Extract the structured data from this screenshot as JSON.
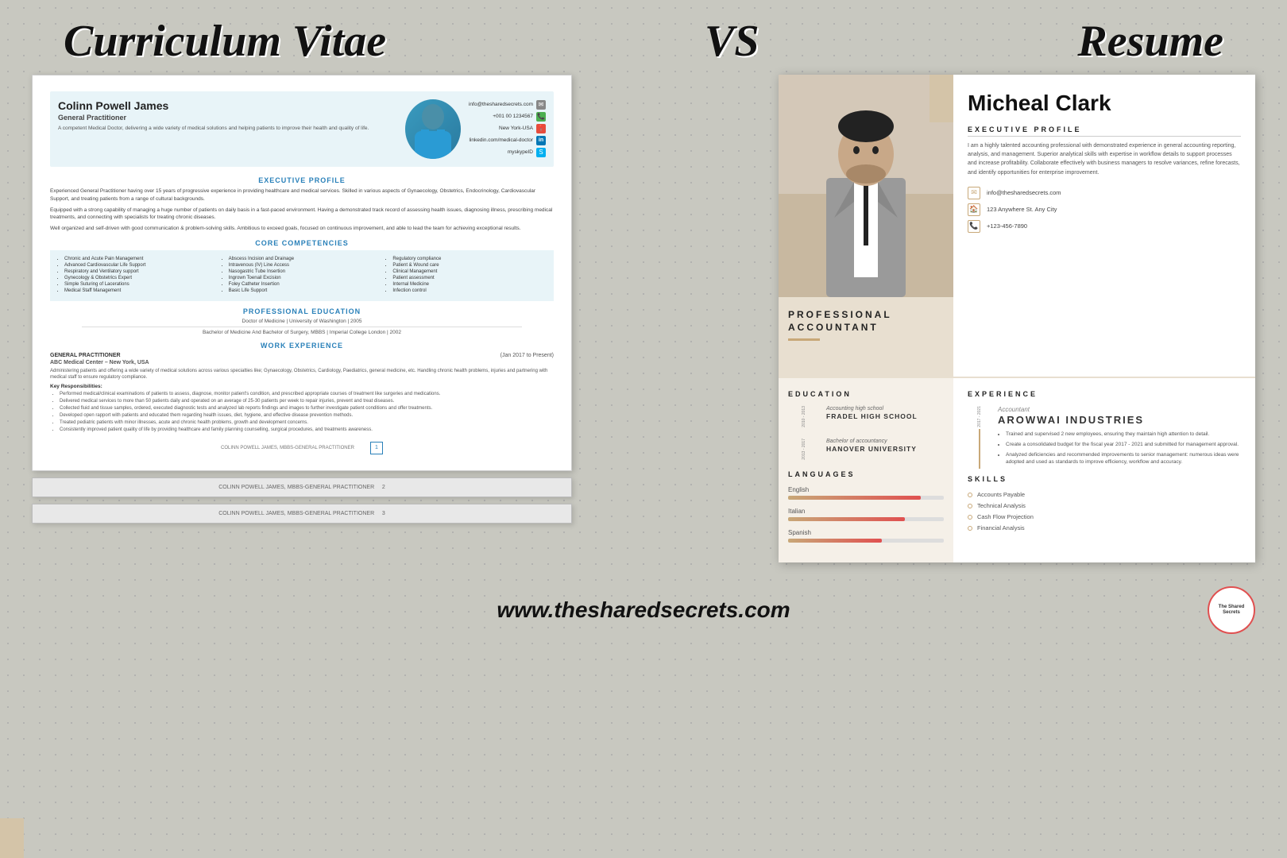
{
  "header": {
    "cv_title": "Curriculum Vitae",
    "vs_text": "VS",
    "resume_title": "Resume"
  },
  "cv": {
    "name": "Colinn Powell James",
    "job_title": "General Practitioner",
    "description": "A competent Medical Doctor, delivering a wide variety of medical solutions and helping patients to improve their health and quality of life.",
    "contact": {
      "email": "info@thesharedsecrets.com",
      "phone": "+001 00 1234567",
      "location": "New York-USA",
      "linkedin": "linkedin.com/medical-doctor",
      "skype": "myskypeID"
    },
    "executive_profile_title": "EXECUTIVE PROFILE",
    "profile_text_1": "Experienced General Practitioner having over 15 years of progressive experience in providing healthcare and medical services. Skilled in various aspects of Gynaecology, Obstetrics, Endocrinology, Cardiovascular Support, and treating patients from a range of cultural backgrounds.",
    "profile_text_2": "Equipped with a strong capability of managing a huge number of patients on daily basis in a fast-paced environment. Having a demonstrated track record of assessing health issues, diagnosing illness, prescribing medical treatments, and connecting with specialists for treating chronic diseases.",
    "profile_text_3": "Well organized and self-driven with good communication & problem-solving skills. Ambitious to exceed goals, focused on continuous improvement, and able to lead the team for achieving exceptional results.",
    "competencies_title": "CORE COMPETENCIES",
    "competencies_col1": [
      "Chronic and Acute Pain Management",
      "Advanced Cardiovascular Life Support",
      "Respiratory and Ventilatory support",
      "Gynecology & Obstetrics Expert",
      "Simple Suturing of Lacerations",
      "Medical Staff Management"
    ],
    "competencies_col2": [
      "Abscess Incision and Drainage",
      "Intravenous (IV) Line Access",
      "Nasogastric Tube Insertion",
      "Ingrown Toenail Excision",
      "Foley Catheter Insertion",
      "Basic Life Support"
    ],
    "competencies_col3": [
      "Regulatory compliance",
      "Patient & Wound care",
      "Clinical Management",
      "Patient assessment",
      "Internal Medicine",
      "Infection control"
    ],
    "education_title": "PROFESSIONAL EDUCATION",
    "edu_1": "Doctor of Medicine | University of Washington | 2005",
    "edu_2": "Bachelor of Medicine And Bachelor of Surgery, MBBS | Imperial College London | 2002",
    "work_title": "WORK EXPERIENCE",
    "work_role": "GENERAL PRACTITIONER",
    "work_org": "ABC Medical Center – New York, USA",
    "work_date": "(Jan 2017 to Present)",
    "work_desc": "Administering patients and offering a wide variety of medical solutions across various specialties like; Gynaecology, Obstetrics, Cardiology, Paediatrics, general medicine, etc. Handling chronic health problems, injuries and partnering with medical staff to ensure regulatory compliance.",
    "work_resp_title": "Key Responsibilities:",
    "work_bullets": [
      "Performed medical/clinical examinations of patients to assess, diagnose, monitor patient's condition, and prescribed appropriate courses of treatment like surgeries and medications.",
      "Delivered medical services to more than 50 patients daily and operated on an average of 25-30 patients per week to repair injuries, prevent and treat diseases.",
      "Collected fluid and tissue samples, ordered, executed diagnostic tests and analyzed lab reports findings and images to further investigate patient conditions and offer treatments.",
      "Developed open rapport with patients and educated them regarding health issues, diet, hygiene, and effective disease prevention methods.",
      "Treated pediatric patients with minor illnesses, acute and chronic health problems, growth and development concerns.",
      "Consistently improved patient quality of life by providing healthcare and family planning counselling, surgical procedures, and treatments awareness."
    ],
    "footer_text": "COLINN POWELL JAMES, MBBS-GENERAL PRACTITIONER",
    "page_num": "1",
    "page2_footer": "COLINN POWELL JAMES, MBBS-GENERAL PRACTITIONER",
    "page2_num": "2",
    "page3_footer": "COLINN POWELL JAMES, MBBS-GENERAL PRACTITIONER",
    "page3_num": "3"
  },
  "resume": {
    "name": "Micheal Clark",
    "prof_title_line1": "PROFESSIONAL",
    "prof_title_line2": "ACCOUNTANT",
    "executive_profile_title": "EXECUTIVE PROFILE",
    "profile_text": "I am a highly talented accounting professional with demonstrated experience in general accounting reporting, analysis, and management. Superior analytical skills with expertise in workflow details to support processes and increase profitability. Collaborate effectively with business managers to resolve variances, refine forecasts, and identify opportunities for enterprise improvement.",
    "contact": {
      "email": "info@thesharedsecrets.com",
      "address": "123 Anywhere St. Any City",
      "phone": "+123-456-7890"
    },
    "education_title": "EDUCATION",
    "education": [
      {
        "years": "2010 - 2013",
        "degree": "Accounting high school",
        "school": "FRADEL HIGH SCHOOL"
      },
      {
        "years": "2013 - 2017",
        "degree": "Bachelor of accountancy",
        "school": "HANOVER UNIVERSITY"
      }
    ],
    "languages_title": "LANGUAGES",
    "languages": [
      {
        "name": "English",
        "level": 85
      },
      {
        "name": "Italian",
        "level": 75
      },
      {
        "name": "Spanish",
        "level": 60
      }
    ],
    "experience_title": "EXPERIENCE",
    "exp_years": "2017 - 2021",
    "exp_role": "Accountant",
    "exp_company": "AROWWAI INDUSTRIES",
    "exp_bullets": [
      "Trained and supervised 2 new employees, ensuring they maintain high attention to detail.",
      "Create a consolidated budget for the fiscal year 2017 - 2021 and submitted for management approval.",
      "Analyzed deficiencies and recommended improvements to senior management: numerous ideas were adopted and used as standards to improve efficiency, workflow and accuracy."
    ],
    "skills_title": "SKILLS",
    "skills": [
      "Accounts Payable",
      "Technical Analysis",
      "Cash Flow Projection",
      "Financial Analysis"
    ]
  },
  "footer": {
    "website": "www.thesharedsecrets.com",
    "logo_text": "The Shared\nSecrets"
  }
}
